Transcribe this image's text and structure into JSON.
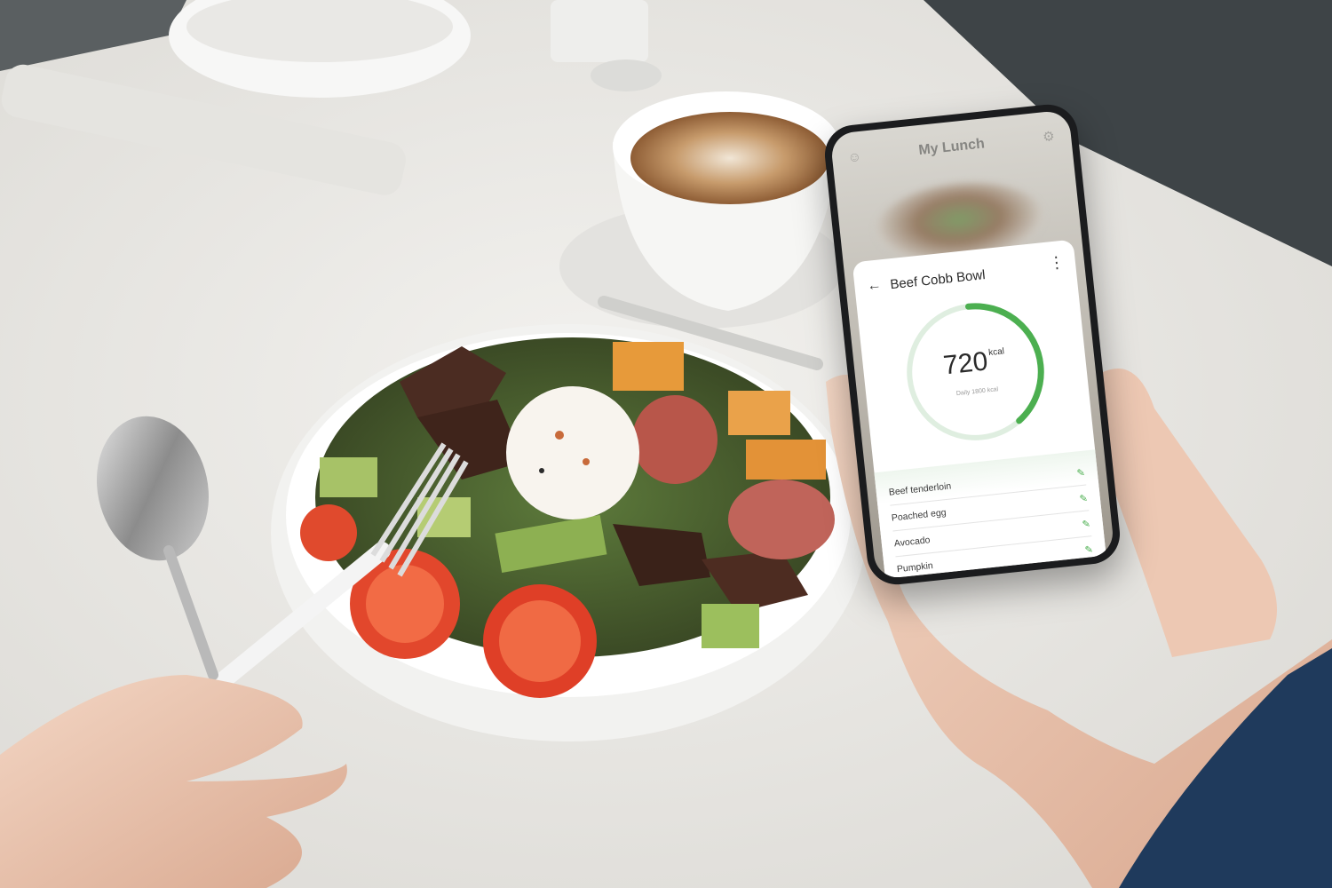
{
  "app": {
    "header_title": "My Lunch",
    "meal_name": "Beef Cobb Bowl",
    "calories": "720",
    "calories_unit": "kcal",
    "daily_goal_label": "Daily 1800 kcal",
    "progress_fraction": 0.4
  },
  "ingredients": [
    {
      "name": "Beef tenderloin"
    },
    {
      "name": "Poached egg"
    },
    {
      "name": "Avocado"
    },
    {
      "name": "Pumpkin"
    }
  ],
  "colors": {
    "accent": "#4caf50",
    "ring_track": "#dfeee0"
  },
  "icons": {
    "back": "arrow-left-icon",
    "more": "more-vertical-icon",
    "edit": "pencil-icon",
    "header_left": "user-icon",
    "header_right": "settings-icon"
  }
}
